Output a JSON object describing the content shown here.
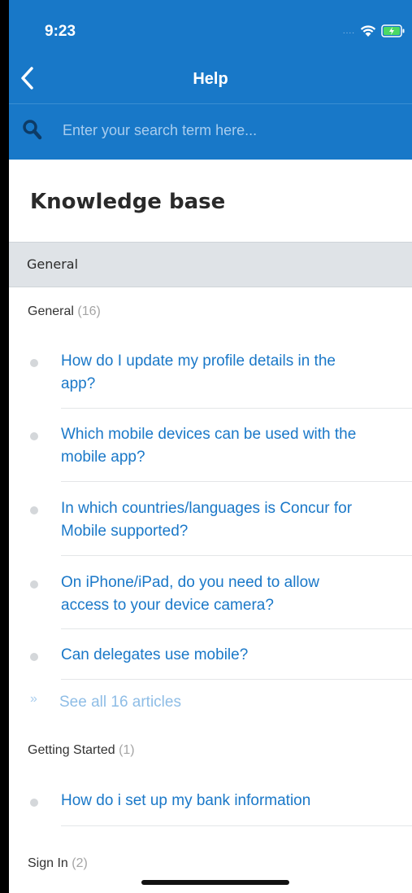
{
  "status": {
    "time": "9:23",
    "signal": "....",
    "wifi_icon": "wifi-icon",
    "battery_icon": "battery-charging-icon"
  },
  "nav": {
    "title": "Help",
    "back_icon": "chevron-left-icon"
  },
  "search": {
    "placeholder": "Enter your search term here...",
    "value": ""
  },
  "knowledge_base": {
    "title": "Knowledge base"
  },
  "section": {
    "label": "General"
  },
  "groups": [
    {
      "name": "General",
      "count": "(16)",
      "articles": [
        {
          "line1": "How do I update my profile details in the",
          "line2": "app?"
        },
        {
          "line1": "Which mobile devices can be used with the",
          "line2": "mobile app?"
        },
        {
          "line1": "In which countries/languages is Concur for",
          "line2": "Mobile supported?"
        },
        {
          "line1": "On iPhone/iPad, do you need to allow",
          "line2": "access to your device camera?"
        },
        {
          "line1": "Can delegates use mobile?",
          "line2": ""
        }
      ],
      "see_all": {
        "chevron": "»",
        "label": "See all 16 articles"
      }
    },
    {
      "name": "Getting Started",
      "count": "(1)",
      "articles": [
        {
          "line1": "How do i set up my bank information",
          "line2": ""
        }
      ]
    },
    {
      "name": "Sign In",
      "count": "(2)",
      "articles": []
    }
  ],
  "colors": {
    "header": "#1878c8",
    "link": "#1a78c8",
    "band": "#dfe3e7"
  }
}
